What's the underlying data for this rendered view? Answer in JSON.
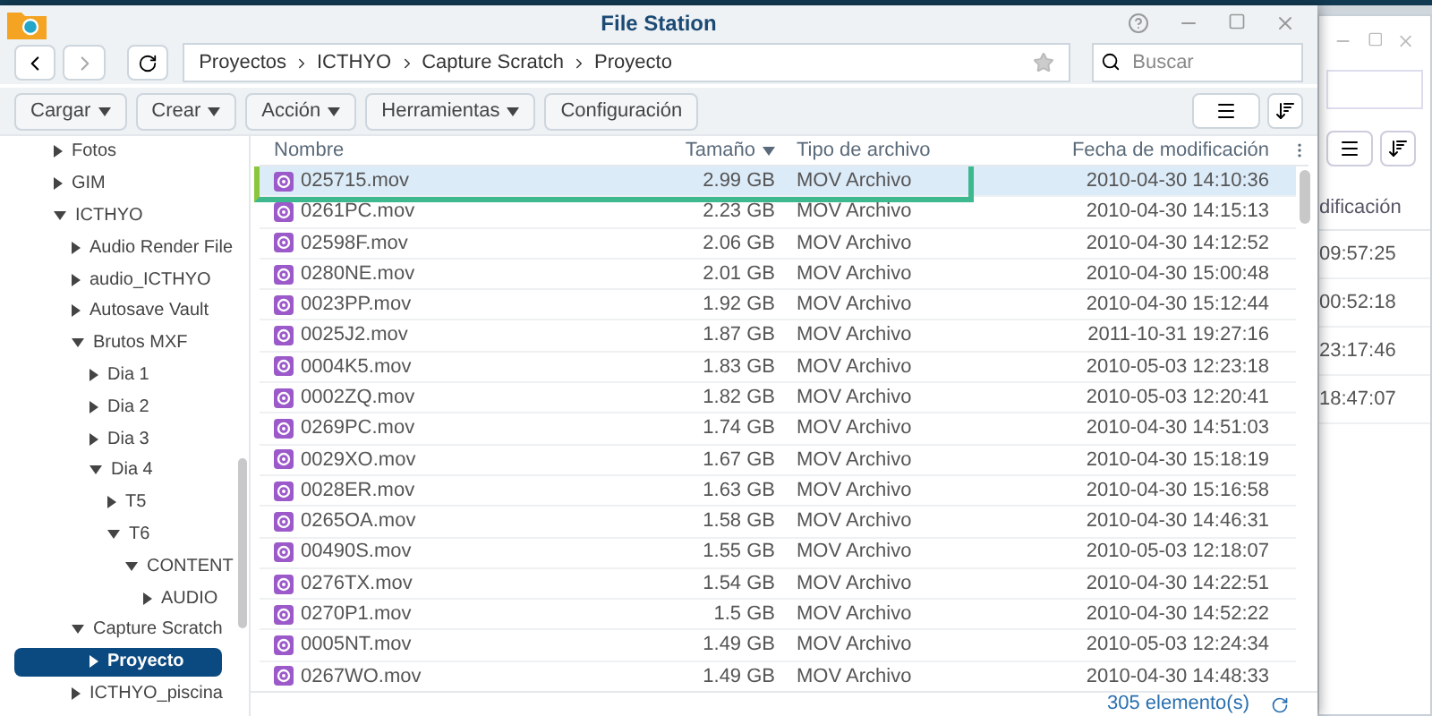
{
  "window": {
    "title": "File Station"
  },
  "path": [
    "Proyectos",
    "ICTHYO",
    "Capture Scratch",
    "Proyecto"
  ],
  "search": {
    "placeholder": "Buscar"
  },
  "toolbar": [
    {
      "label": "Cargar",
      "dropdown": true
    },
    {
      "label": "Crear",
      "dropdown": true
    },
    {
      "label": "Acción",
      "dropdown": true
    },
    {
      "label": "Herramientas",
      "dropdown": true
    },
    {
      "label": "Configuración",
      "dropdown": false
    }
  ],
  "tree": [
    {
      "label": "Fotos",
      "expanded": false,
      "selected": false
    },
    {
      "label": "GIM",
      "expanded": false,
      "selected": false
    },
    {
      "label": "ICTHYO",
      "expanded": true,
      "selected": false,
      "children": [
        {
          "label": "Audio Render File",
          "expanded": false,
          "selected": false
        },
        {
          "label": "audio_ICTHYO",
          "expanded": false,
          "selected": false
        },
        {
          "label": "Autosave Vault",
          "expanded": false,
          "selected": false
        },
        {
          "label": "Brutos MXF",
          "expanded": true,
          "selected": false,
          "children": [
            {
              "label": "Dia 1",
              "expanded": false,
              "selected": false
            },
            {
              "label": "Dia 2",
              "expanded": false,
              "selected": false
            },
            {
              "label": "Dia 3",
              "expanded": false,
              "selected": false
            },
            {
              "label": "Dia 4",
              "expanded": true,
              "selected": false,
              "children": [
                {
                  "label": "T5",
                  "expanded": false,
                  "selected": false
                },
                {
                  "label": "T6",
                  "expanded": true,
                  "selected": false,
                  "children": [
                    {
                      "label": "CONTENT",
                      "expanded": true,
                      "selected": false,
                      "children": [
                        {
                          "label": "AUDIO",
                          "expanded": false,
                          "selected": false
                        }
                      ]
                    }
                  ]
                }
              ]
            }
          ]
        },
        {
          "label": "Capture Scratch",
          "expanded": true,
          "selected": false,
          "children": [
            {
              "label": "Proyecto",
              "expanded": false,
              "selected": true
            }
          ]
        },
        {
          "label": "ICTHYO_piscina",
          "expanded": false,
          "selected": false
        }
      ]
    }
  ],
  "table": {
    "columns": [
      "Nombre",
      "Tamaño",
      "Tipo de archivo",
      "Fecha de modificación"
    ],
    "rows": [
      {
        "name": "025715.mov",
        "size": "2.99 GB",
        "type": "MOV Archivo",
        "date": "2010-04-30 14:10:36",
        "selected": true
      },
      {
        "name": "0261PC.mov",
        "size": "2.23 GB",
        "type": "MOV Archivo",
        "date": "2010-04-30 14:15:13",
        "selected": false
      },
      {
        "name": "02598F.mov",
        "size": "2.06 GB",
        "type": "MOV Archivo",
        "date": "2010-04-30 14:12:52",
        "selected": false
      },
      {
        "name": "0280NE.mov",
        "size": "2.01 GB",
        "type": "MOV Archivo",
        "date": "2010-04-30 15:00:48",
        "selected": false
      },
      {
        "name": "0023PP.mov",
        "size": "1.92 GB",
        "type": "MOV Archivo",
        "date": "2010-04-30 15:12:44",
        "selected": false
      },
      {
        "name": "0025J2.mov",
        "size": "1.87 GB",
        "type": "MOV Archivo",
        "date": "2011-10-31 19:27:16",
        "selected": false
      },
      {
        "name": "0004K5.mov",
        "size": "1.83 GB",
        "type": "MOV Archivo",
        "date": "2010-05-03 12:23:18",
        "selected": false
      },
      {
        "name": "0002ZQ.mov",
        "size": "1.82 GB",
        "type": "MOV Archivo",
        "date": "2010-05-03 12:20:41",
        "selected": false
      },
      {
        "name": "0269PC.mov",
        "size": "1.74 GB",
        "type": "MOV Archivo",
        "date": "2010-04-30 14:51:03",
        "selected": false
      },
      {
        "name": "0029XO.mov",
        "size": "1.67 GB",
        "type": "MOV Archivo",
        "date": "2010-04-30 15:18:19",
        "selected": false
      },
      {
        "name": "0028ER.mov",
        "size": "1.63 GB",
        "type": "MOV Archivo",
        "date": "2010-04-30 15:16:58",
        "selected": false
      },
      {
        "name": "0265OA.mov",
        "size": "1.58 GB",
        "type": "MOV Archivo",
        "date": "2010-04-30 14:46:31",
        "selected": false
      },
      {
        "name": "00490S.mov",
        "size": "1.55 GB",
        "type": "MOV Archivo",
        "date": "2010-05-03 12:18:07",
        "selected": false
      },
      {
        "name": "0276TX.mov",
        "size": "1.54 GB",
        "type": "MOV Archivo",
        "date": "2010-04-30 14:22:51",
        "selected": false
      },
      {
        "name": "0270P1.mov",
        "size": "1.5 GB",
        "type": "MOV Archivo",
        "date": "2010-04-30 14:52:22",
        "selected": false
      },
      {
        "name": "0005NT.mov",
        "size": "1.49 GB",
        "type": "MOV Archivo",
        "date": "2010-05-03 12:24:34",
        "selected": false
      },
      {
        "name": "0267WO.mov",
        "size": "1.49 GB",
        "type": "MOV Archivo",
        "date": "2010-04-30 14:48:33",
        "selected": false
      }
    ]
  },
  "status_bar": {
    "count": "305 elemento(s)"
  },
  "background_window": {
    "column": "dificación",
    "times": [
      "09:57:25",
      "00:52:18",
      "23:17:46",
      "18:47:07"
    ]
  }
}
